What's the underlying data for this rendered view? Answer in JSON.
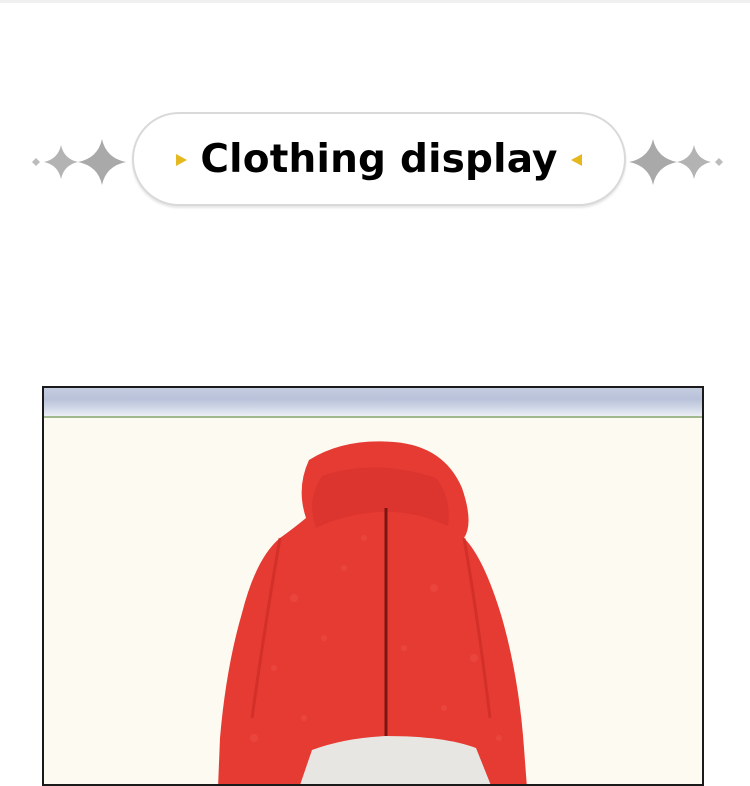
{
  "section": {
    "title": "Clothing display"
  },
  "decoration": {
    "sparkle_color": "#b5b5b5",
    "arrow_color": "#e6b820",
    "pill_border_color": "#d9d9d9"
  },
  "product": {
    "image": "red fleece hooded zip-up onesie with white pouch pocket",
    "main_color": "#e53b34",
    "pocket_color": "#e8e6e3",
    "background_color": "#fdfaf2"
  }
}
